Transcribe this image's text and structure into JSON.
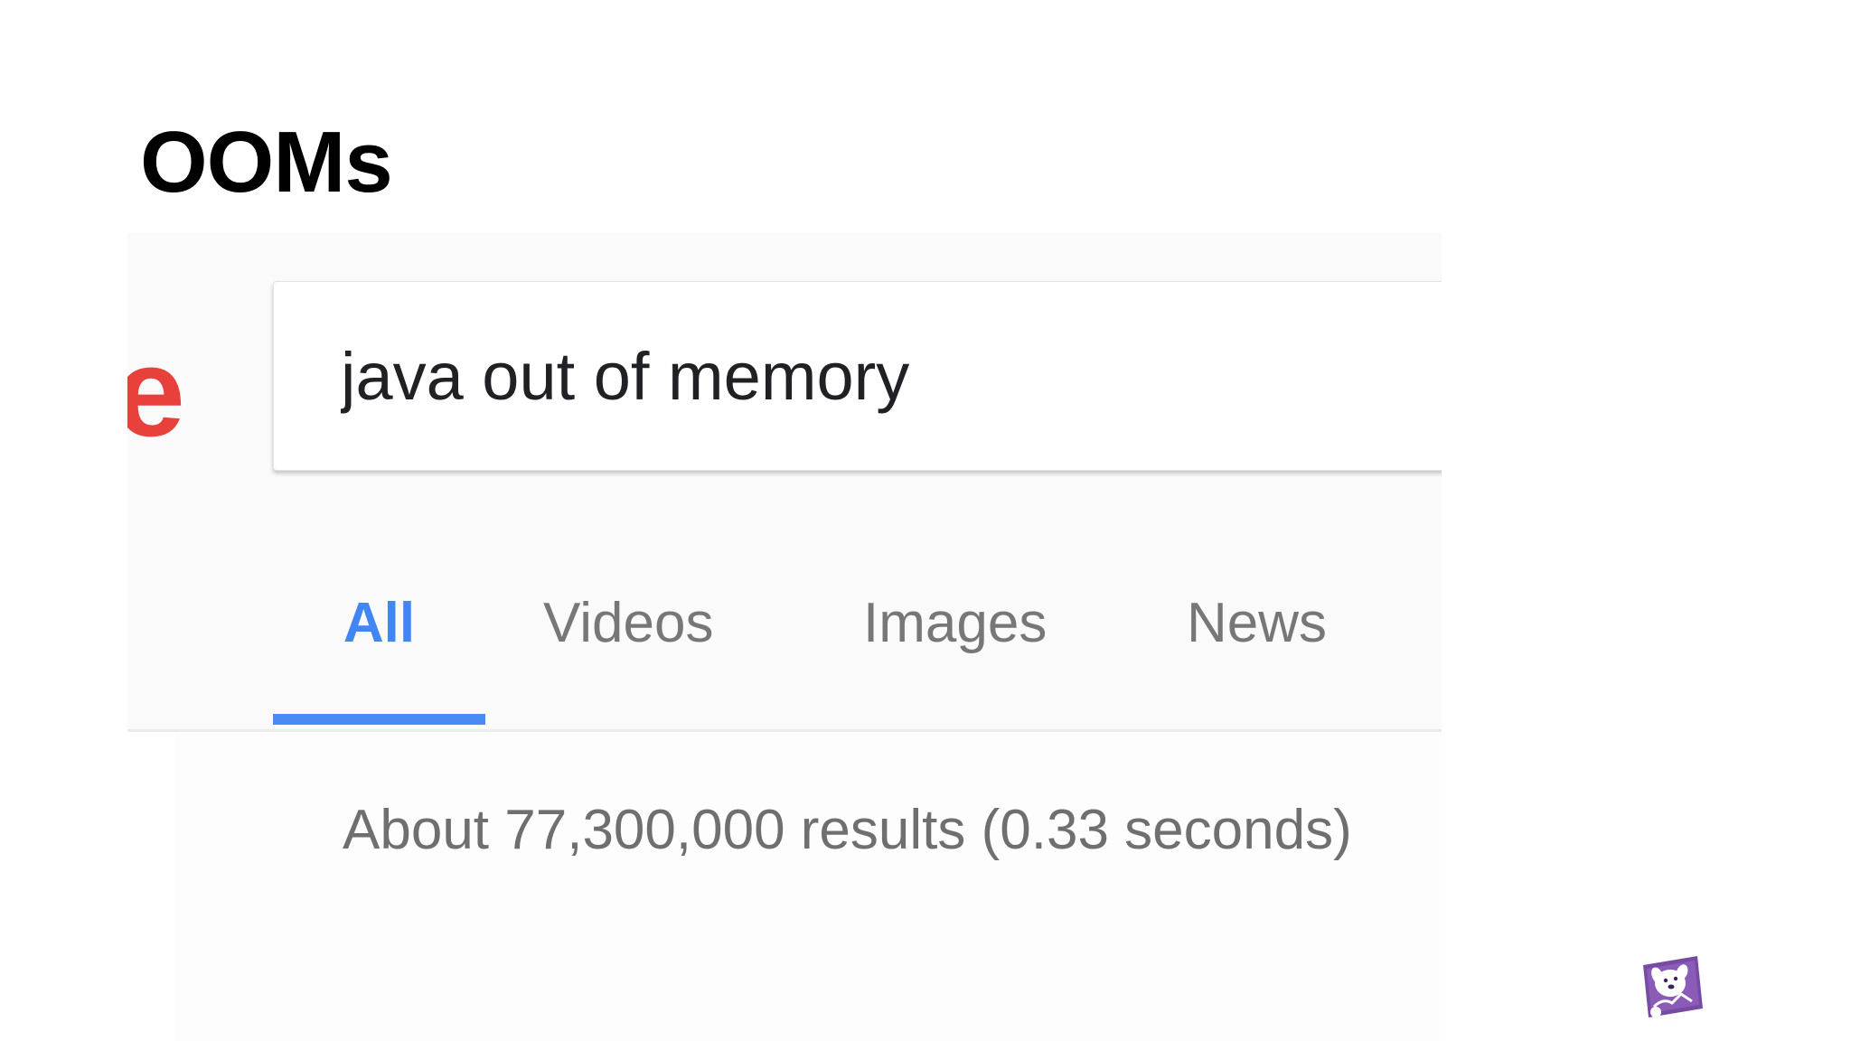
{
  "slide": {
    "title": "OOMs"
  },
  "search_page": {
    "logo_fragment": "e",
    "query": "java out of memory",
    "tabs": [
      {
        "label": "All",
        "active": true
      },
      {
        "label": "Videos",
        "active": false
      },
      {
        "label": "Images",
        "active": false
      },
      {
        "label": "News",
        "active": false
      }
    ],
    "result_stats": "About 77,300,000 results (0.33 seconds)"
  },
  "colors": {
    "active_tab": "#4285f4",
    "logo_red": "#e8413b",
    "brand_purple": "#774aa4"
  },
  "brand": {
    "icon": "datadog-dog-icon"
  }
}
